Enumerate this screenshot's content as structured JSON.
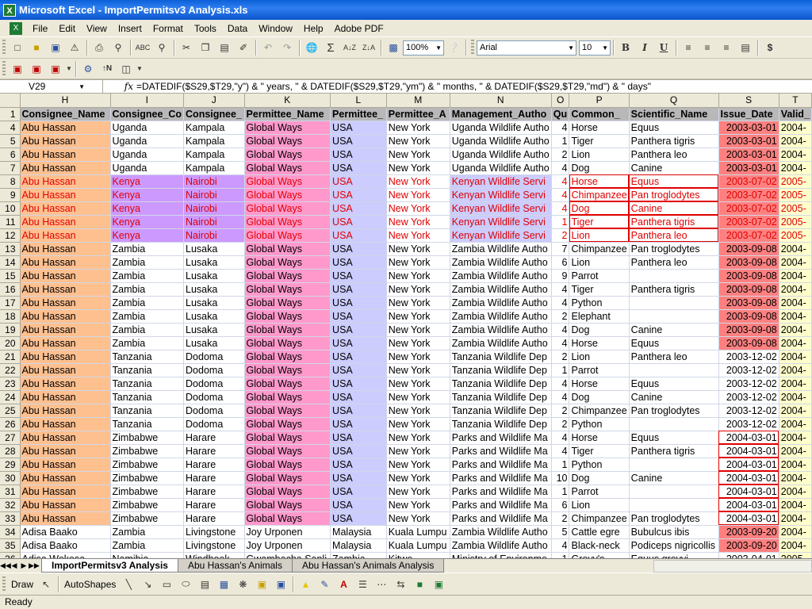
{
  "window": {
    "title": "Microsoft Excel - ImportPermitsv3 Analysis.xls"
  },
  "menu": [
    "File",
    "Edit",
    "View",
    "Insert",
    "Format",
    "Tools",
    "Data",
    "Window",
    "Help",
    "Adobe PDF"
  ],
  "toolbar": {
    "zoom": "100%",
    "font_name": "Arial",
    "font_size": "10",
    "bold": "B",
    "italic": "I",
    "underline": "U",
    "currency": "$"
  },
  "formula_bar": {
    "name_box": "V29",
    "fx": "fx",
    "formula": "=DATEDIF($S29,$T29,\"y\") & \" years, \" & DATEDIF($S29,$T29,\"ym\") & \" months, \" & DATEDIF($S29,$T29,\"md\") & \" days\""
  },
  "columns": [
    "H",
    "I",
    "J",
    "K",
    "L",
    "M",
    "N",
    "O",
    "P",
    "Q",
    "S",
    "T"
  ],
  "header_row": [
    "Consignee_Name",
    "Consignee_Co",
    "Consignee_",
    "Permittee_Name",
    "Permittee_",
    "Permittee_A",
    "Management_Autho",
    "Qu",
    "Common_",
    "Scientific_Name",
    "Issue_Date",
    "Valid_"
  ],
  "rows": [
    {
      "n": "4",
      "style": "u",
      "c": [
        "Abu Hassan",
        "Uganda",
        "Kampala",
        "Global Ways",
        "USA",
        "New York",
        "Uganda Wildlife Autho",
        "4",
        "Horse",
        "Equus",
        "2003-03-01",
        "2004-"
      ]
    },
    {
      "n": "5",
      "style": "u",
      "c": [
        "Abu Hassan",
        "Uganda",
        "Kampala",
        "Global Ways",
        "USA",
        "New York",
        "Uganda Wildlife Autho",
        "1",
        "Tiger",
        "Panthera tigris",
        "2003-03-01",
        "2004-"
      ]
    },
    {
      "n": "6",
      "style": "u",
      "c": [
        "Abu Hassan",
        "Uganda",
        "Kampala",
        "Global Ways",
        "USA",
        "New York",
        "Uganda Wildlife Autho",
        "2",
        "Lion",
        "Panthera leo",
        "2003-03-01",
        "2004-"
      ]
    },
    {
      "n": "7",
      "style": "u",
      "c": [
        "Abu Hassan",
        "Uganda",
        "Kampala",
        "Global Ways",
        "USA",
        "New York",
        "Uganda Wildlife Autho",
        "4",
        "Dog",
        "Canine",
        "2003-03-01",
        "2004-"
      ]
    },
    {
      "n": "8",
      "style": "k",
      "c": [
        "Abu Hassan",
        "Kenya",
        "Nairobi",
        "Global Ways",
        "USA",
        "New York",
        "Kenyan Wildlife Servi",
        "4",
        "Horse",
        "Equus",
        "2003-07-02",
        "2005-"
      ]
    },
    {
      "n": "9",
      "style": "k",
      "c": [
        "Abu Hassan",
        "Kenya",
        "Nairobi",
        "Global Ways",
        "USA",
        "New York",
        "Kenyan Wildlife Servi",
        "4",
        "Chimpanzee",
        "Pan troglodytes",
        "2003-07-02",
        "2005-"
      ]
    },
    {
      "n": "10",
      "style": "k",
      "c": [
        "Abu Hassan",
        "Kenya",
        "Nairobi",
        "Global Ways",
        "USA",
        "New York",
        "Kenyan Wildlife Servi",
        "4",
        "Dog",
        "Canine",
        "2003-07-02",
        "2005-"
      ]
    },
    {
      "n": "11",
      "style": "k",
      "c": [
        "Abu Hassan",
        "Kenya",
        "Nairobi",
        "Global Ways",
        "USA",
        "New York",
        "Kenyan Wildlife Servi",
        "1",
        "Tiger",
        "Panthera tigris",
        "2003-07-02",
        "2005-"
      ]
    },
    {
      "n": "12",
      "style": "k",
      "c": [
        "Abu Hassan",
        "Kenya",
        "Nairobi",
        "Global Ways",
        "USA",
        "New York",
        "Kenyan Wildlife Servi",
        "2",
        "Lion",
        "Panthera leo",
        "2003-07-02",
        "2005-"
      ]
    },
    {
      "n": "13",
      "style": "z",
      "c": [
        "Abu Hassan",
        "Zambia",
        "Lusaka",
        "Global Ways",
        "USA",
        "New York",
        "Zambia Wildlife Autho",
        "7",
        "Chimpanzee",
        "Pan troglodytes",
        "2003-09-08",
        "2004-"
      ]
    },
    {
      "n": "14",
      "style": "z",
      "c": [
        "Abu Hassan",
        "Zambia",
        "Lusaka",
        "Global Ways",
        "USA",
        "New York",
        "Zambia Wildlife Autho",
        "6",
        "Lion",
        "Panthera leo",
        "2003-09-08",
        "2004-"
      ]
    },
    {
      "n": "15",
      "style": "z",
      "c": [
        "Abu Hassan",
        "Zambia",
        "Lusaka",
        "Global Ways",
        "USA",
        "New York",
        "Zambia Wildlife Autho",
        "9",
        "Parrot",
        "",
        "2003-09-08",
        "2004-"
      ]
    },
    {
      "n": "16",
      "style": "z",
      "c": [
        "Abu Hassan",
        "Zambia",
        "Lusaka",
        "Global Ways",
        "USA",
        "New York",
        "Zambia Wildlife Autho",
        "4",
        "Tiger",
        "Panthera tigris",
        "2003-09-08",
        "2004-"
      ]
    },
    {
      "n": "17",
      "style": "z",
      "c": [
        "Abu Hassan",
        "Zambia",
        "Lusaka",
        "Global Ways",
        "USA",
        "New York",
        "Zambia Wildlife Autho",
        "4",
        "Python",
        "",
        "2003-09-08",
        "2004-"
      ]
    },
    {
      "n": "18",
      "style": "z",
      "c": [
        "Abu Hassan",
        "Zambia",
        "Lusaka",
        "Global Ways",
        "USA",
        "New York",
        "Zambia Wildlife Autho",
        "2",
        "Elephant",
        "",
        "2003-09-08",
        "2004-"
      ]
    },
    {
      "n": "19",
      "style": "z",
      "c": [
        "Abu Hassan",
        "Zambia",
        "Lusaka",
        "Global Ways",
        "USA",
        "New York",
        "Zambia Wildlife Autho",
        "4",
        "Dog",
        "Canine",
        "2003-09-08",
        "2004-"
      ]
    },
    {
      "n": "20",
      "style": "z",
      "c": [
        "Abu Hassan",
        "Zambia",
        "Lusaka",
        "Global Ways",
        "USA",
        "New York",
        "Zambia Wildlife Autho",
        "4",
        "Horse",
        "Equus",
        "2003-09-08",
        "2004-"
      ]
    },
    {
      "n": "21",
      "style": "t",
      "c": [
        "Abu Hassan",
        "Tanzania",
        "Dodoma",
        "Global Ways",
        "USA",
        "New York",
        "Tanzania Wildlife Dep",
        "2",
        "Lion",
        "Panthera leo",
        "2003-12-02",
        "2004-"
      ]
    },
    {
      "n": "22",
      "style": "t",
      "c": [
        "Abu Hassan",
        "Tanzania",
        "Dodoma",
        "Global Ways",
        "USA",
        "New York",
        "Tanzania Wildlife Dep",
        "1",
        "Parrot",
        "",
        "2003-12-02",
        "2004-"
      ]
    },
    {
      "n": "23",
      "style": "t",
      "c": [
        "Abu Hassan",
        "Tanzania",
        "Dodoma",
        "Global Ways",
        "USA",
        "New York",
        "Tanzania Wildlife Dep",
        "4",
        "Horse",
        "Equus",
        "2003-12-02",
        "2004-"
      ]
    },
    {
      "n": "24",
      "style": "t",
      "c": [
        "Abu Hassan",
        "Tanzania",
        "Dodoma",
        "Global Ways",
        "USA",
        "New York",
        "Tanzania Wildlife Dep",
        "4",
        "Dog",
        "Canine",
        "2003-12-02",
        "2004-"
      ]
    },
    {
      "n": "25",
      "style": "t",
      "c": [
        "Abu Hassan",
        "Tanzania",
        "Dodoma",
        "Global Ways",
        "USA",
        "New York",
        "Tanzania Wildlife Dep",
        "2",
        "Chimpanzee",
        "Pan troglodytes",
        "2003-12-02",
        "2004-"
      ]
    },
    {
      "n": "26",
      "style": "t",
      "c": [
        "Abu Hassan",
        "Tanzania",
        "Dodoma",
        "Global Ways",
        "USA",
        "New York",
        "Tanzania Wildlife Dep",
        "2",
        "Python",
        "",
        "2003-12-02",
        "2004-"
      ]
    },
    {
      "n": "27",
      "style": "w",
      "c": [
        "Abu Hassan",
        "Zimbabwe",
        "Harare",
        "Global Ways",
        "USA",
        "New York",
        "Parks and Wildlife Ma",
        "4",
        "Horse",
        "Equus",
        "2004-03-01",
        "2004-"
      ]
    },
    {
      "n": "28",
      "style": "w",
      "c": [
        "Abu Hassan",
        "Zimbabwe",
        "Harare",
        "Global Ways",
        "USA",
        "New York",
        "Parks and Wildlife Ma",
        "4",
        "Tiger",
        "Panthera tigris",
        "2004-03-01",
        "2004-"
      ]
    },
    {
      "n": "29",
      "style": "w",
      "c": [
        "Abu Hassan",
        "Zimbabwe",
        "Harare",
        "Global Ways",
        "USA",
        "New York",
        "Parks and Wildlife Ma",
        "1",
        "Python",
        "",
        "2004-03-01",
        "2004-"
      ]
    },
    {
      "n": "30",
      "style": "w",
      "c": [
        "Abu Hassan",
        "Zimbabwe",
        "Harare",
        "Global Ways",
        "USA",
        "New York",
        "Parks and Wildlife Ma",
        "10",
        "Dog",
        "Canine",
        "2004-03-01",
        "2004-"
      ]
    },
    {
      "n": "31",
      "style": "w",
      "c": [
        "Abu Hassan",
        "Zimbabwe",
        "Harare",
        "Global Ways",
        "USA",
        "New York",
        "Parks and Wildlife Ma",
        "1",
        "Parrot",
        "",
        "2004-03-01",
        "2004-"
      ]
    },
    {
      "n": "32",
      "style": "w",
      "c": [
        "Abu Hassan",
        "Zimbabwe",
        "Harare",
        "Global Ways",
        "USA",
        "New York",
        "Parks and Wildlife Ma",
        "6",
        "Lion",
        "",
        "2004-03-01",
        "2004-"
      ]
    },
    {
      "n": "33",
      "style": "w",
      "c": [
        "Abu Hassan",
        "Zimbabwe",
        "Harare",
        "Global Ways",
        "USA",
        "New York",
        "Parks and Wildlife Ma",
        "2",
        "Chimpanzee",
        "Pan troglodytes",
        "2004-03-01",
        "2004-"
      ]
    },
    {
      "n": "34",
      "style": "a",
      "c": [
        "Adisa Baako",
        "Zambia",
        "Livingstone",
        "Joy Urponen",
        "Malaysia",
        "Kuala Lumpu",
        "Zambia Wildlife Autho",
        "5",
        "Cattle egre",
        "Bubulcus ibis",
        "2003-09-20",
        "2004-"
      ]
    },
    {
      "n": "35",
      "style": "a",
      "c": [
        "Adisa Baako",
        "Zambia",
        "Livingstone",
        "Joy Urponen",
        "Malaysia",
        "Kuala Lumpu",
        "Zambia Wildlife Autho",
        "4",
        "Black-neck",
        "Podiceps nigricollis",
        "2003-09-20",
        "2004-"
      ]
    },
    {
      "n": "36",
      "style": "p",
      "c": [
        "Adisa Wekesa",
        "Namibia",
        "Windhoek",
        "Gwambacha Sanli",
        "Zambia",
        "Kitwe",
        "Ministry of Environme",
        "1",
        "Grevy's",
        "Equus grevyi",
        "2003-04-01",
        "2005-"
      ]
    }
  ],
  "sheet_tabs": [
    "ImportPermitsv3 Analysis",
    "Abu Hassan's Animals",
    "Abu Hassan's Animals Analysis"
  ],
  "drawing": {
    "draw": "Draw",
    "autoshapes": "AutoShapes"
  },
  "status": "Ready",
  "colors": {
    "orange": "#ffc090",
    "pink": "#ff99cc",
    "lavender": "#ccccff",
    "purple": "#cc99ff",
    "red": "#ff8080",
    "yellow": "#ffffcc"
  }
}
